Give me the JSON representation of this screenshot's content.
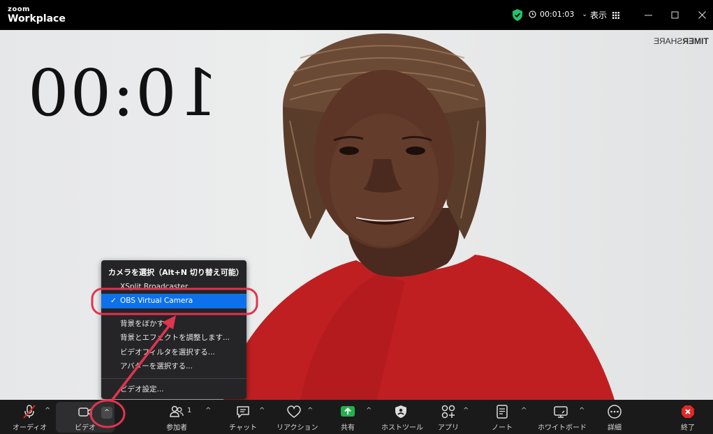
{
  "titlebar": {
    "logo_small": "zoom",
    "logo_big": "Workplace",
    "elapsed": "00:01:03",
    "view_label": "表示"
  },
  "video": {
    "mirror_timer": "10:00",
    "brand_bold": "TIMER",
    "brand_light": "SHARE"
  },
  "menu": {
    "title": "カメラを選択（Alt+N 切り替え可能）",
    "cameras": [
      "XSplit Broadcaster",
      "OBS Virtual Camera"
    ],
    "selected_camera": "OBS Virtual Camera",
    "check": "✓",
    "options": [
      "背景をぼかす",
      "背景とエフェクトを調整します...",
      "ビデオフィルタを選択する...",
      "アバターを選択する..."
    ],
    "settings": "ビデオ設定..."
  },
  "toolbar": {
    "audio": "オーディオ",
    "video": "ビデオ",
    "participants": "参加者",
    "participants_count": "1",
    "chat": "チャット",
    "reactions": "リアクション",
    "share": "共有",
    "host_tools": "ホストツール",
    "apps": "アプリ",
    "notes": "ノート",
    "whiteboard": "ホワイトボード",
    "more": "詳細",
    "end": "終了"
  },
  "colors": {
    "accent": "#0e71eb",
    "share_green": "#22b14c",
    "end_red": "#e02828",
    "annotation": "#e0344f",
    "shield_green": "#23c26b"
  }
}
